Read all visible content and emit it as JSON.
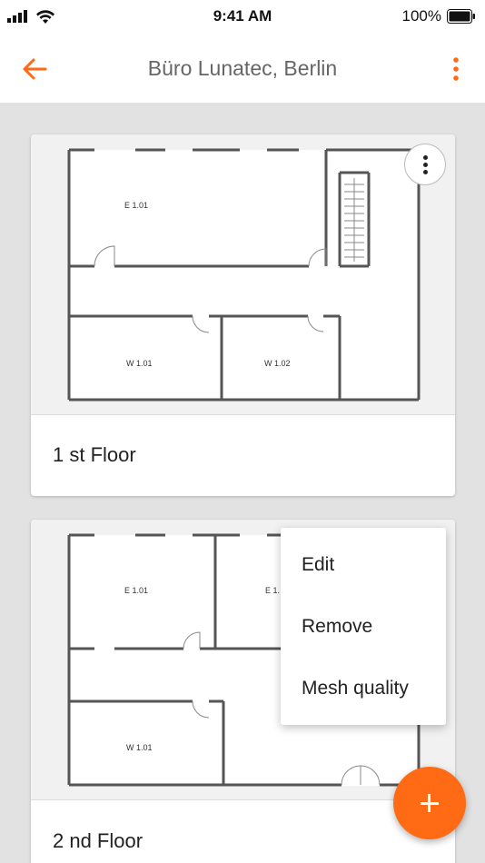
{
  "status_bar": {
    "time": "9:41 AM",
    "battery": "100%"
  },
  "app_bar": {
    "title": "Büro Lunatec, Berlin"
  },
  "floors": [
    {
      "label": "1 st Floor",
      "rooms": [
        "E 1.01",
        "W 1.01",
        "W 1.02"
      ]
    },
    {
      "label": "2 nd Floor",
      "rooms": [
        "E 1.01",
        "E 1.",
        "W 1.01"
      ]
    }
  ],
  "menu": {
    "items": [
      "Edit",
      "Remove",
      "Mesh quality"
    ]
  },
  "colors": {
    "accent": "#ff6a14",
    "background": "#e2e2e2",
    "card": "#ffffff"
  },
  "icons": {
    "back": "arrow-left-icon",
    "more": "more-vertical-icon",
    "add": "plus-icon"
  }
}
